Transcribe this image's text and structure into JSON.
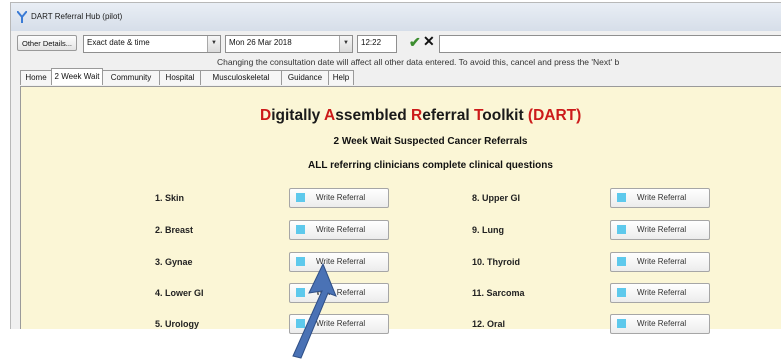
{
  "window": {
    "title": "DART Referral Hub (pilot)"
  },
  "toolbar": {
    "other_details_label": "Other Details...",
    "date_mode_value": "Exact date & time",
    "date_value": "Mon 26 Mar 2018",
    "time_value": "12:22"
  },
  "notice": "Changing the consultation date will affect all other data entered. To avoid this, cancel and press the 'Next' b",
  "tabs": [
    "Home",
    "2 Week Wait",
    "Community",
    "Hospital",
    "Musculoskeletal",
    "Guidance",
    "Help"
  ],
  "active_tab": "2 Week Wait",
  "heading": {
    "w1": "D",
    "r1": "igitally ",
    "w2": "A",
    "r2": "ssembled ",
    "w3": "R",
    "r3": "eferral ",
    "w4": "T",
    "r4": "oolkit ",
    "suffix": "(DART)"
  },
  "subtitle": "2 Week Wait Suspected Cancer Referrals",
  "instruction": "ALL referring clinicians complete clinical questions",
  "referrals_left": [
    "1. Skin",
    "2. Breast",
    "3. Gynae",
    "4. Lower GI",
    "5. Urology"
  ],
  "referrals_right": [
    "8. Upper GI",
    "9. Lung",
    "10. Thyroid",
    "11. Sarcoma",
    "12. Oral"
  ],
  "write_referral_label": "Write Referral",
  "colors": {
    "accent_red": "#cc1a1a",
    "panel_bg": "#fbf6d6",
    "button_icon": "#5ec9ec",
    "arrow": "#4a72b5"
  }
}
